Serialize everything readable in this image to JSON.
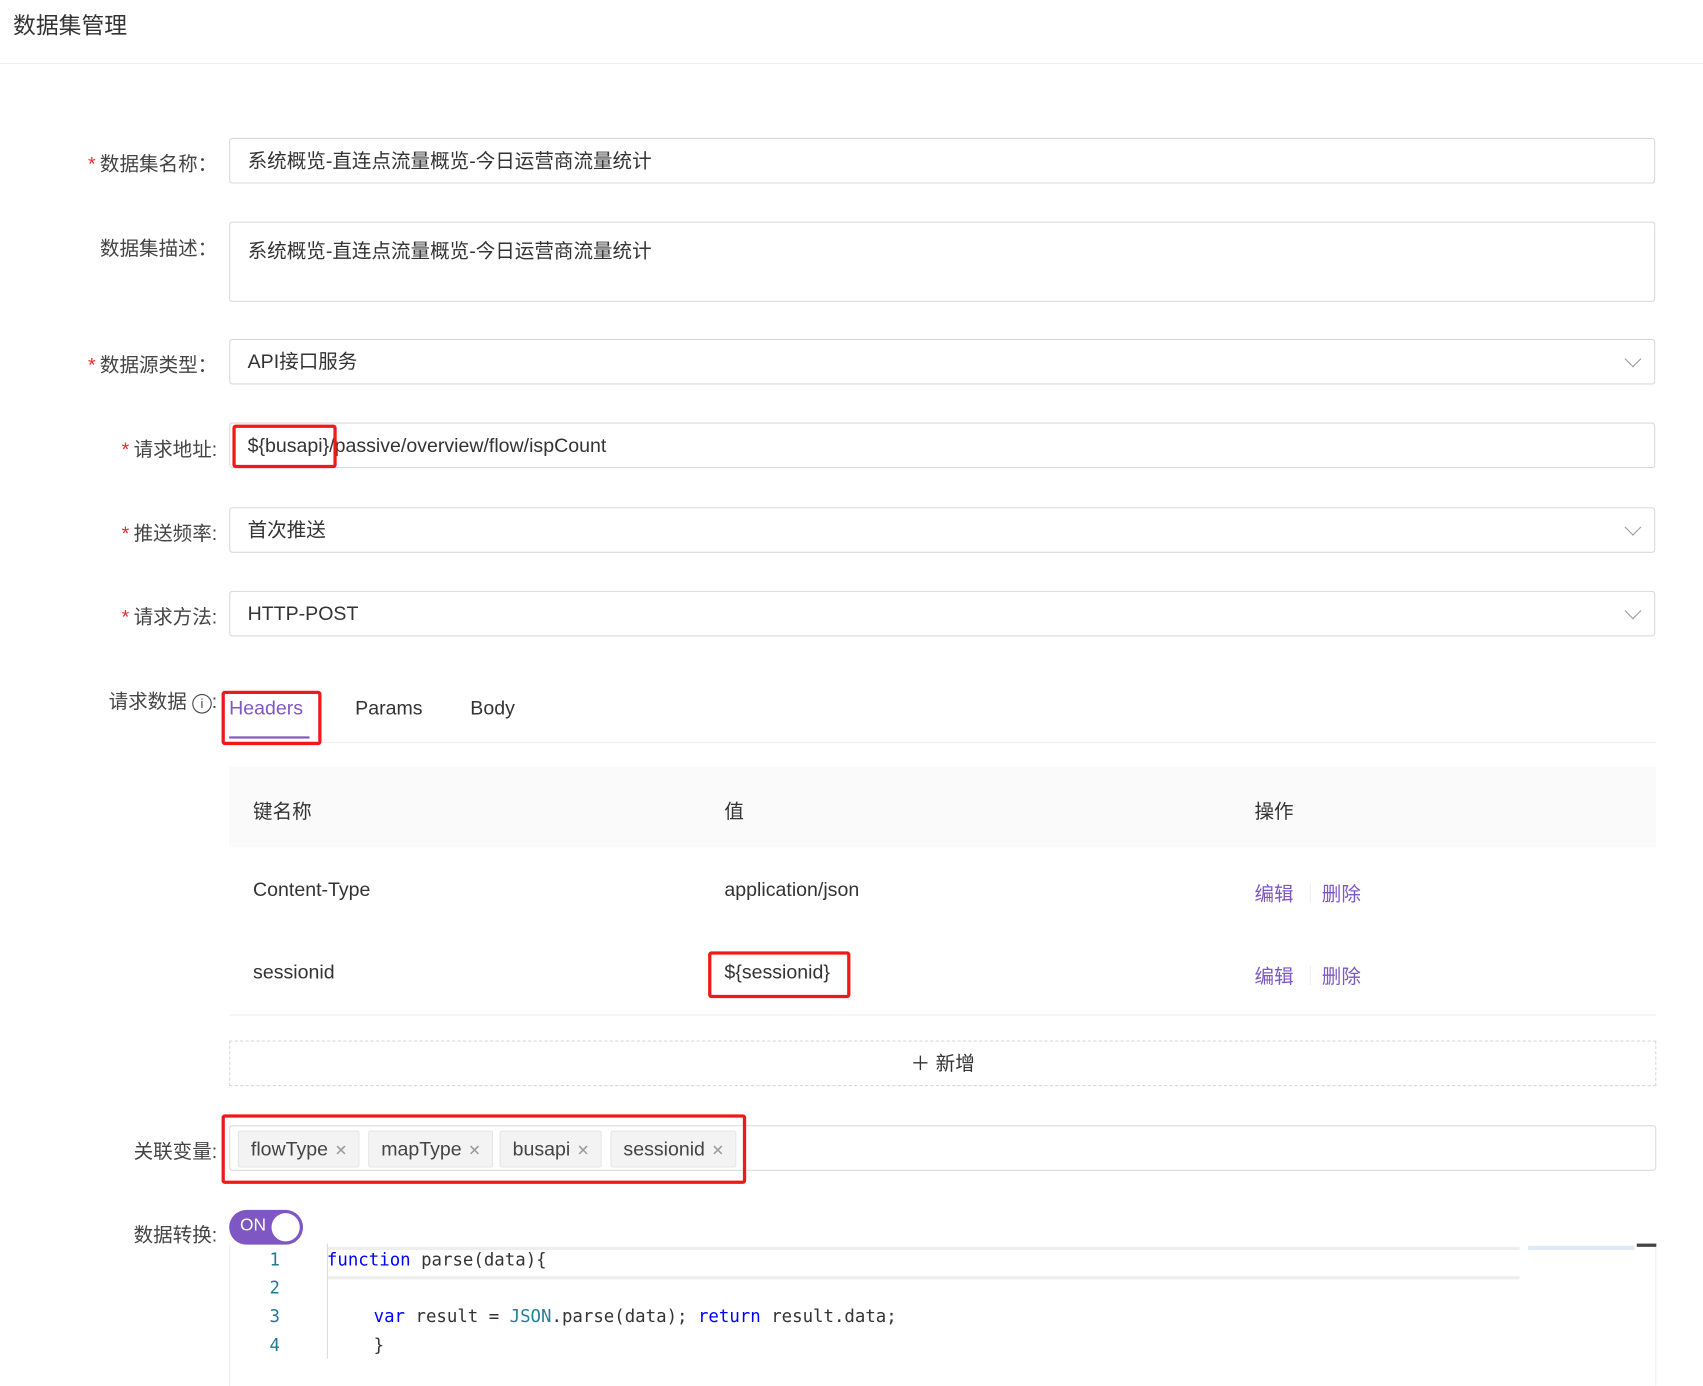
{
  "page": {
    "title": "数据集管理"
  },
  "form": {
    "name": {
      "label": "数据集名称",
      "value": "系统概览-直连点流量概览-今日运营商流量统计",
      "required": true
    },
    "desc": {
      "label": "数据集描述",
      "value": "系统概览-直连点流量概览-今日运营商流量统计"
    },
    "source_type": {
      "label": "数据源类型",
      "value": "API接口服务",
      "required": true
    },
    "url": {
      "label": "请求地址",
      "prefix": "${busapi}",
      "rest": "/passive/overview/flow/ispCount",
      "required": true
    },
    "frequency": {
      "label": "推送频率",
      "value": "首次推送",
      "required": true
    },
    "method": {
      "label": "请求方法",
      "value": "HTTP-POST",
      "required": true
    },
    "request_data": {
      "label": "请求数据",
      "tabs": [
        {
          "label": "Headers",
          "active": true
        },
        {
          "label": "Params"
        },
        {
          "label": "Body"
        }
      ],
      "columns": [
        "键名称",
        "值",
        "操作"
      ],
      "rows": [
        {
          "key": "Content-Type",
          "value": "application/json",
          "edit": "编辑",
          "delete": "删除"
        },
        {
          "key": "sessionid",
          "value": "${sessionid}",
          "edit": "编辑",
          "delete": "删除"
        }
      ],
      "add_label": "新增"
    },
    "variables": {
      "label": "关联变量",
      "tags": [
        "flowType",
        "mapType",
        "busapi",
        "sessionid"
      ]
    },
    "transform": {
      "label": "数据转换",
      "toggle": "ON",
      "enabled": true,
      "code": {
        "lines": [
          "1",
          "2",
          "3",
          "4"
        ],
        "l1_kw": "function",
        "l1_rest": " parse(data){",
        "l3_var": "var",
        "l3_a": " result = ",
        "l3_json": "JSON",
        "l3_b": ".parse(data); ",
        "l3_ret": "return",
        "l3_c": " result.data;",
        "l4": "}"
      }
    }
  },
  "colors": {
    "accent": "#7e57c2",
    "required": "#f5222d",
    "annotation": "#f01818"
  }
}
